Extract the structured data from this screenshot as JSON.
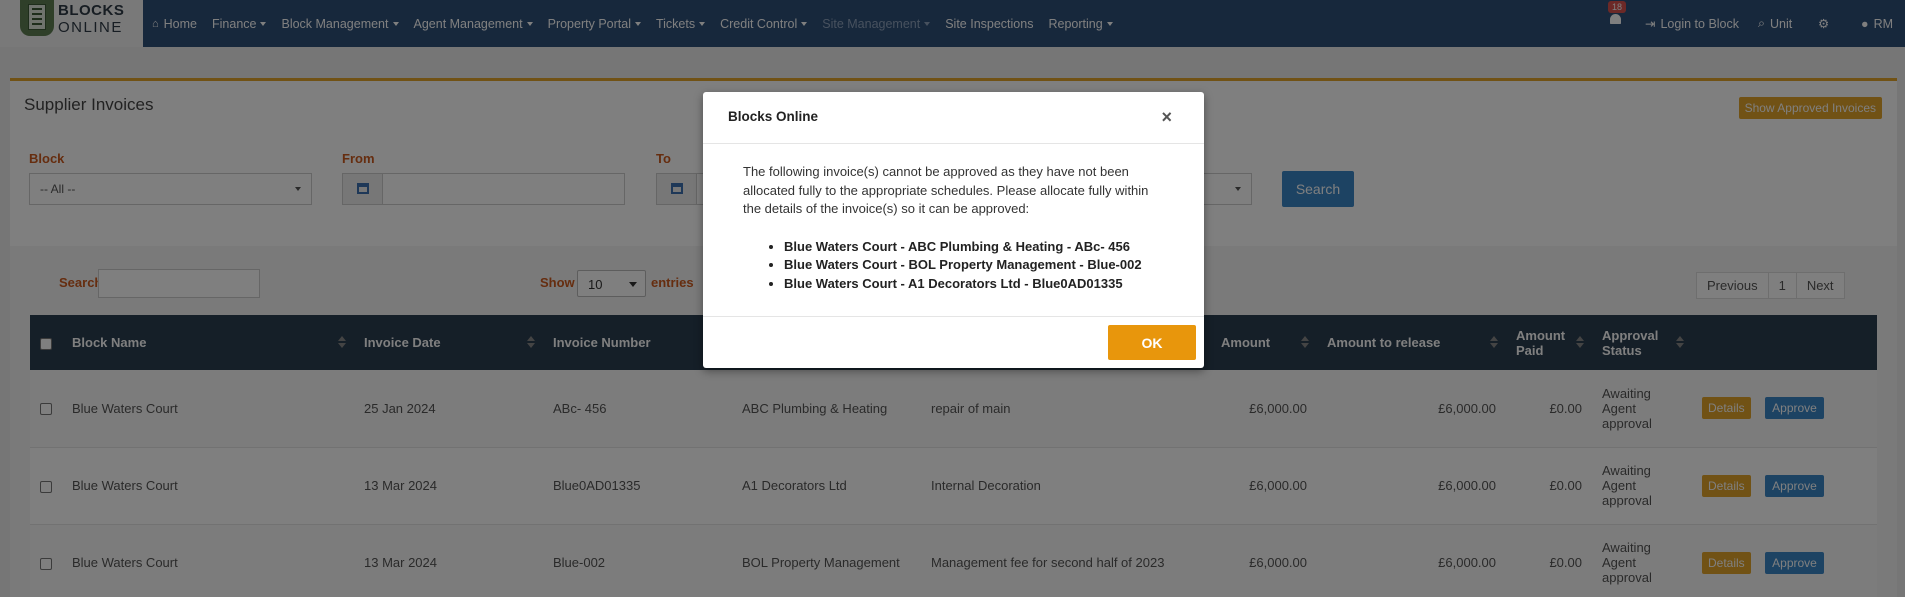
{
  "brand": {
    "line1": "BLOCKS",
    "line2": "ONLINE"
  },
  "nav": {
    "home": "Home",
    "items": [
      "Finance",
      "Block Management",
      "Agent Management",
      "Property Portal",
      "Tickets",
      "Credit Control",
      "Site Management",
      "Site Inspections",
      "Reporting"
    ],
    "notifications": "18",
    "login_to_block": "Login to Block",
    "unit": "Unit",
    "user": "RM"
  },
  "page": {
    "title": "Supplier Invoices",
    "show_approved": "Show Approved Invoices",
    "filters": {
      "block_label": "Block",
      "block_value": "-- All --",
      "from_label": "From",
      "to_label": "To",
      "search_button": "Search"
    },
    "table_controls": {
      "search_label": "Search:",
      "show_label": "Show",
      "entries_value": "10",
      "entries_label": "entries",
      "previous": "Previous",
      "page": "1",
      "next": "Next"
    },
    "columns": [
      "Block Name",
      "Invoice Date",
      "Invoice Number",
      "",
      "",
      "Amount",
      "Amount to release",
      "Amount Paid",
      "Approval Status"
    ],
    "rows": [
      {
        "block": "Blue Waters Court",
        "date": "25 Jan 2024",
        "number": "ABc- 456",
        "supplier": "ABC Plumbing & Heating",
        "description": "repair of main",
        "amount": "£6,000.00",
        "release": "£6,000.00",
        "paid": "£0.00",
        "status": "Awaiting Agent approval"
      },
      {
        "block": "Blue Waters Court",
        "date": "13 Mar 2024",
        "number": "Blue0AD01335",
        "supplier": "A1 Decorators Ltd",
        "description": "Internal Decoration",
        "amount": "£6,000.00",
        "release": "£6,000.00",
        "paid": "£0.00",
        "status": "Awaiting Agent approval"
      },
      {
        "block": "Blue Waters Court",
        "date": "13 Mar 2024",
        "number": "Blue-002",
        "supplier": "BOL Property Management",
        "description": "Management fee for second half of 2023",
        "amount": "£6,000.00",
        "release": "£6,000.00",
        "paid": "£0.00",
        "status": "Awaiting Agent approval"
      }
    ],
    "row_buttons": {
      "details": "Details",
      "approve": "Approve"
    }
  },
  "modal": {
    "title": "Blocks Online",
    "close": "×",
    "message": "The following invoice(s) cannot be approved as they have not been allocated fully to the appropriate schedules. Please allocate fully within the details of the invoice(s) so it can be approved:",
    "items": [
      "Blue Waters Court - ABC Plumbing & Heating - ABc- 456",
      "Blue Waters Court - BOL Property Management - Blue-002",
      "Blue Waters Court - A1 Decorators Ltd - Blue0AD01335"
    ],
    "ok": "OK"
  },
  "colors": {
    "navbar": "#2f5079",
    "accent": "#e2a42a",
    "primary": "#3a87c7",
    "table_header": "#2b3e50"
  }
}
